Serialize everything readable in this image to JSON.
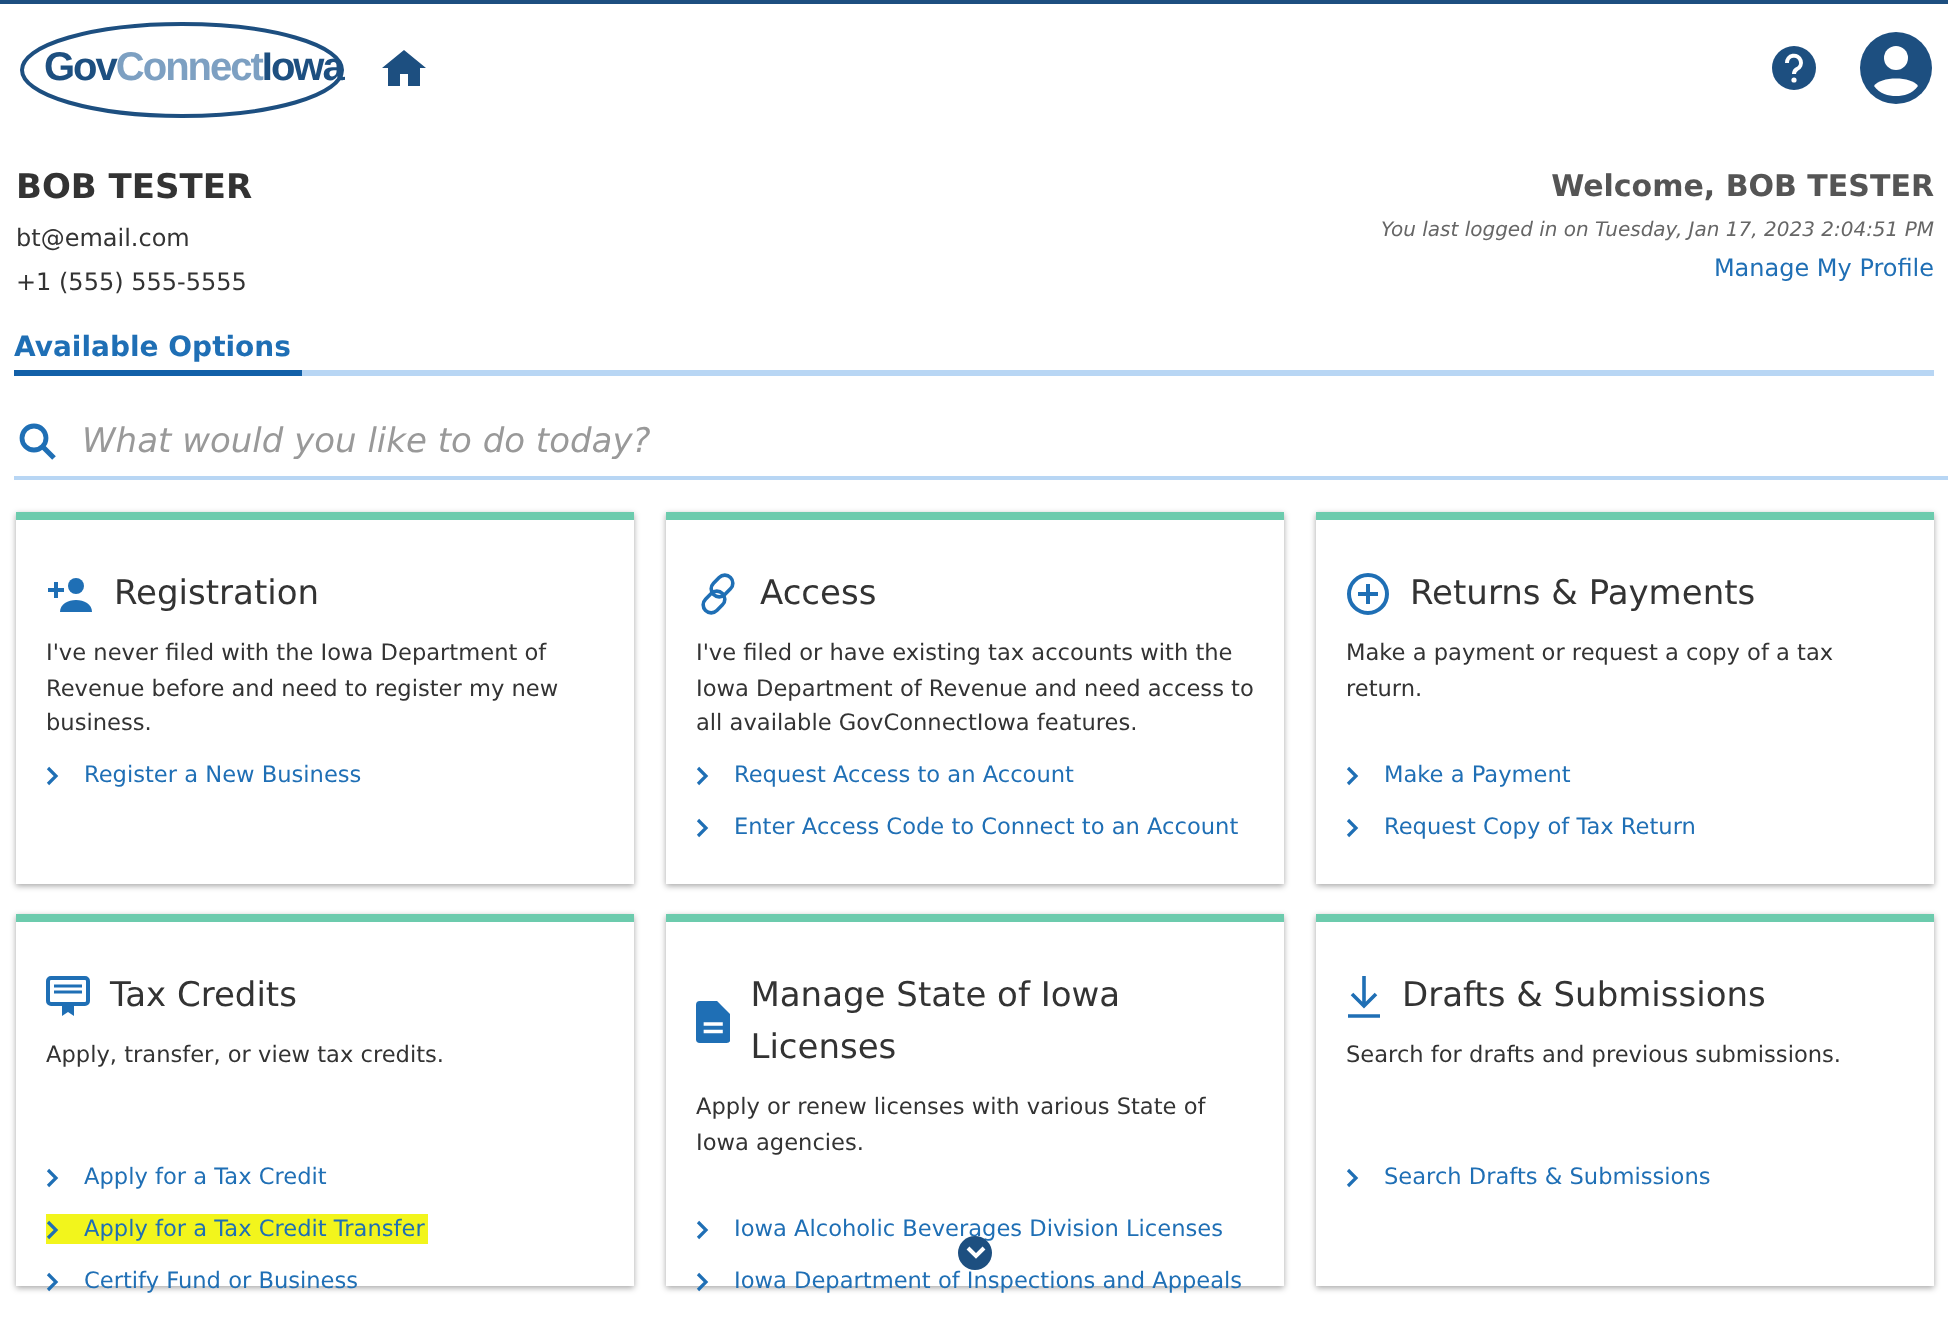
{
  "header": {
    "logo": {
      "part1": "Gov",
      "part2": "Connect",
      "part3": "Iowa"
    }
  },
  "profile": {
    "name": "BOB TESTER",
    "email": "bt@email.com",
    "phone": "+1 (555) 555-5555",
    "welcome": "Welcome, BOB TESTER",
    "last_login": "You last logged in on Tuesday, Jan 17, 2023 2:04:51 PM",
    "manage_link": "Manage My Profile"
  },
  "tabs": [
    {
      "label": "Available Options",
      "selected": true
    }
  ],
  "search": {
    "placeholder": "What would you like to do today?"
  },
  "cards": [
    {
      "kind": "register",
      "title": "Registration",
      "description": "I've never filed with the Iowa Department of Revenue before and need to register my new business.",
      "links": [
        {
          "label": "Register a New Business",
          "highlighted": false
        }
      ]
    },
    {
      "kind": "link",
      "title": "Access",
      "description": "I've filed or have existing tax accounts with the Iowa Department of Revenue and need access to all available GovConnectIowa features.",
      "links": [
        {
          "label": "Request Access to an Account",
          "highlighted": false
        },
        {
          "label": "Enter Access Code to Connect to an Account",
          "highlighted": false
        }
      ]
    },
    {
      "kind": "plus",
      "title": "Returns & Payments",
      "description": "Make a payment or request a copy of a tax return.",
      "links": [
        {
          "label": "Make a Payment",
          "highlighted": false
        },
        {
          "label": "Request Copy of Tax Return",
          "highlighted": false
        }
      ]
    },
    {
      "kind": "certificate",
      "title": "Tax Credits",
      "description": "Apply, transfer, or view tax credits.",
      "links": [
        {
          "label": "Apply for a Tax Credit",
          "highlighted": false
        },
        {
          "label": "Apply for a Tax Credit Transfer",
          "highlighted": true
        },
        {
          "label": "Certify Fund or Business",
          "highlighted": false
        }
      ]
    },
    {
      "kind": "document",
      "title": "Manage State of Iowa Licenses",
      "description": "Apply or renew licenses with various State of Iowa agencies.",
      "links": [
        {
          "label": "Iowa Alcoholic Beverages Division Licenses",
          "highlighted": false
        },
        {
          "label": "Iowa Department of Inspections and Appeals",
          "highlighted": false
        }
      ]
    },
    {
      "kind": "download",
      "title": "Drafts & Submissions",
      "description": "Search for drafts and previous submissions.",
      "links": [
        {
          "label": "Search Drafts & Submissions",
          "highlighted": false
        }
      ]
    }
  ]
}
